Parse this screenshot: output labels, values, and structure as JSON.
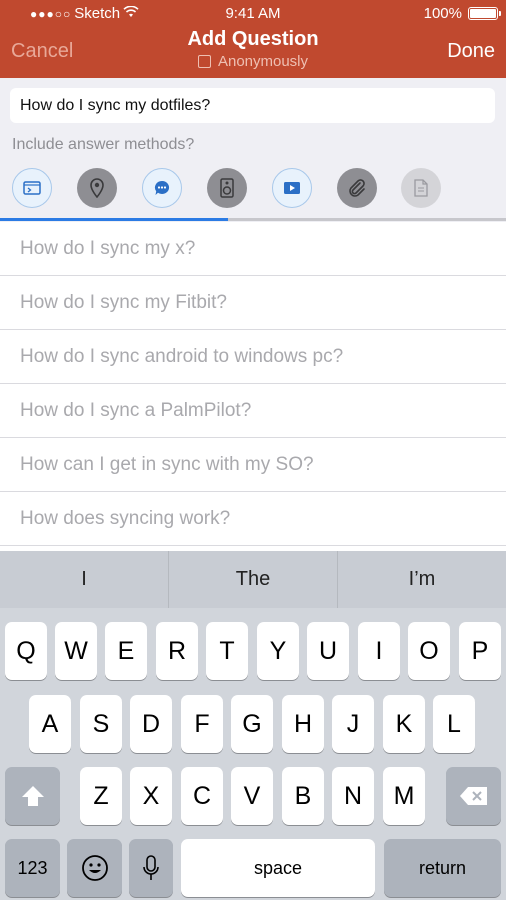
{
  "status_bar": {
    "carrier": "Sketch",
    "time": "9:41 AM",
    "battery": "100%"
  },
  "nav": {
    "cancel": "Cancel",
    "title": "Add Question",
    "done": "Done",
    "anonymous_label": "Anonymously",
    "anonymous_checked": false
  },
  "question": {
    "value": "How do I sync my dotfiles?"
  },
  "methods": {
    "label": "Include answer methods?",
    "items": [
      {
        "icon": "terminal-icon",
        "state": "on"
      },
      {
        "icon": "location-pin-icon",
        "state": "off"
      },
      {
        "icon": "chat-bubble-icon",
        "state": "on"
      },
      {
        "icon": "speaker-icon",
        "state": "off"
      },
      {
        "icon": "video-play-icon",
        "state": "on"
      },
      {
        "icon": "paperclip-icon",
        "state": "off"
      },
      {
        "icon": "document-icon",
        "state": "dim"
      }
    ],
    "progress": 0.45
  },
  "suggestions": [
    "How do I sync my x?",
    "How do I sync my Fitbit?",
    "How do I sync android to windows pc?",
    "How do I sync a PalmPilot?",
    "How can I get in sync with my SO?",
    "How does syncing work?"
  ],
  "keyboard": {
    "predictions": [
      "I",
      "The",
      "I’m"
    ],
    "row1": [
      "Q",
      "W",
      "E",
      "R",
      "T",
      "Y",
      "U",
      "I",
      "O",
      "P"
    ],
    "row2": [
      "A",
      "S",
      "D",
      "F",
      "G",
      "H",
      "J",
      "K",
      "L"
    ],
    "row3": [
      "Z",
      "X",
      "C",
      "V",
      "B",
      "N",
      "M"
    ],
    "numbers": "123",
    "space": "space",
    "return": "return"
  },
  "colors": {
    "header": "#c0492f",
    "accent": "#2b7be4"
  }
}
